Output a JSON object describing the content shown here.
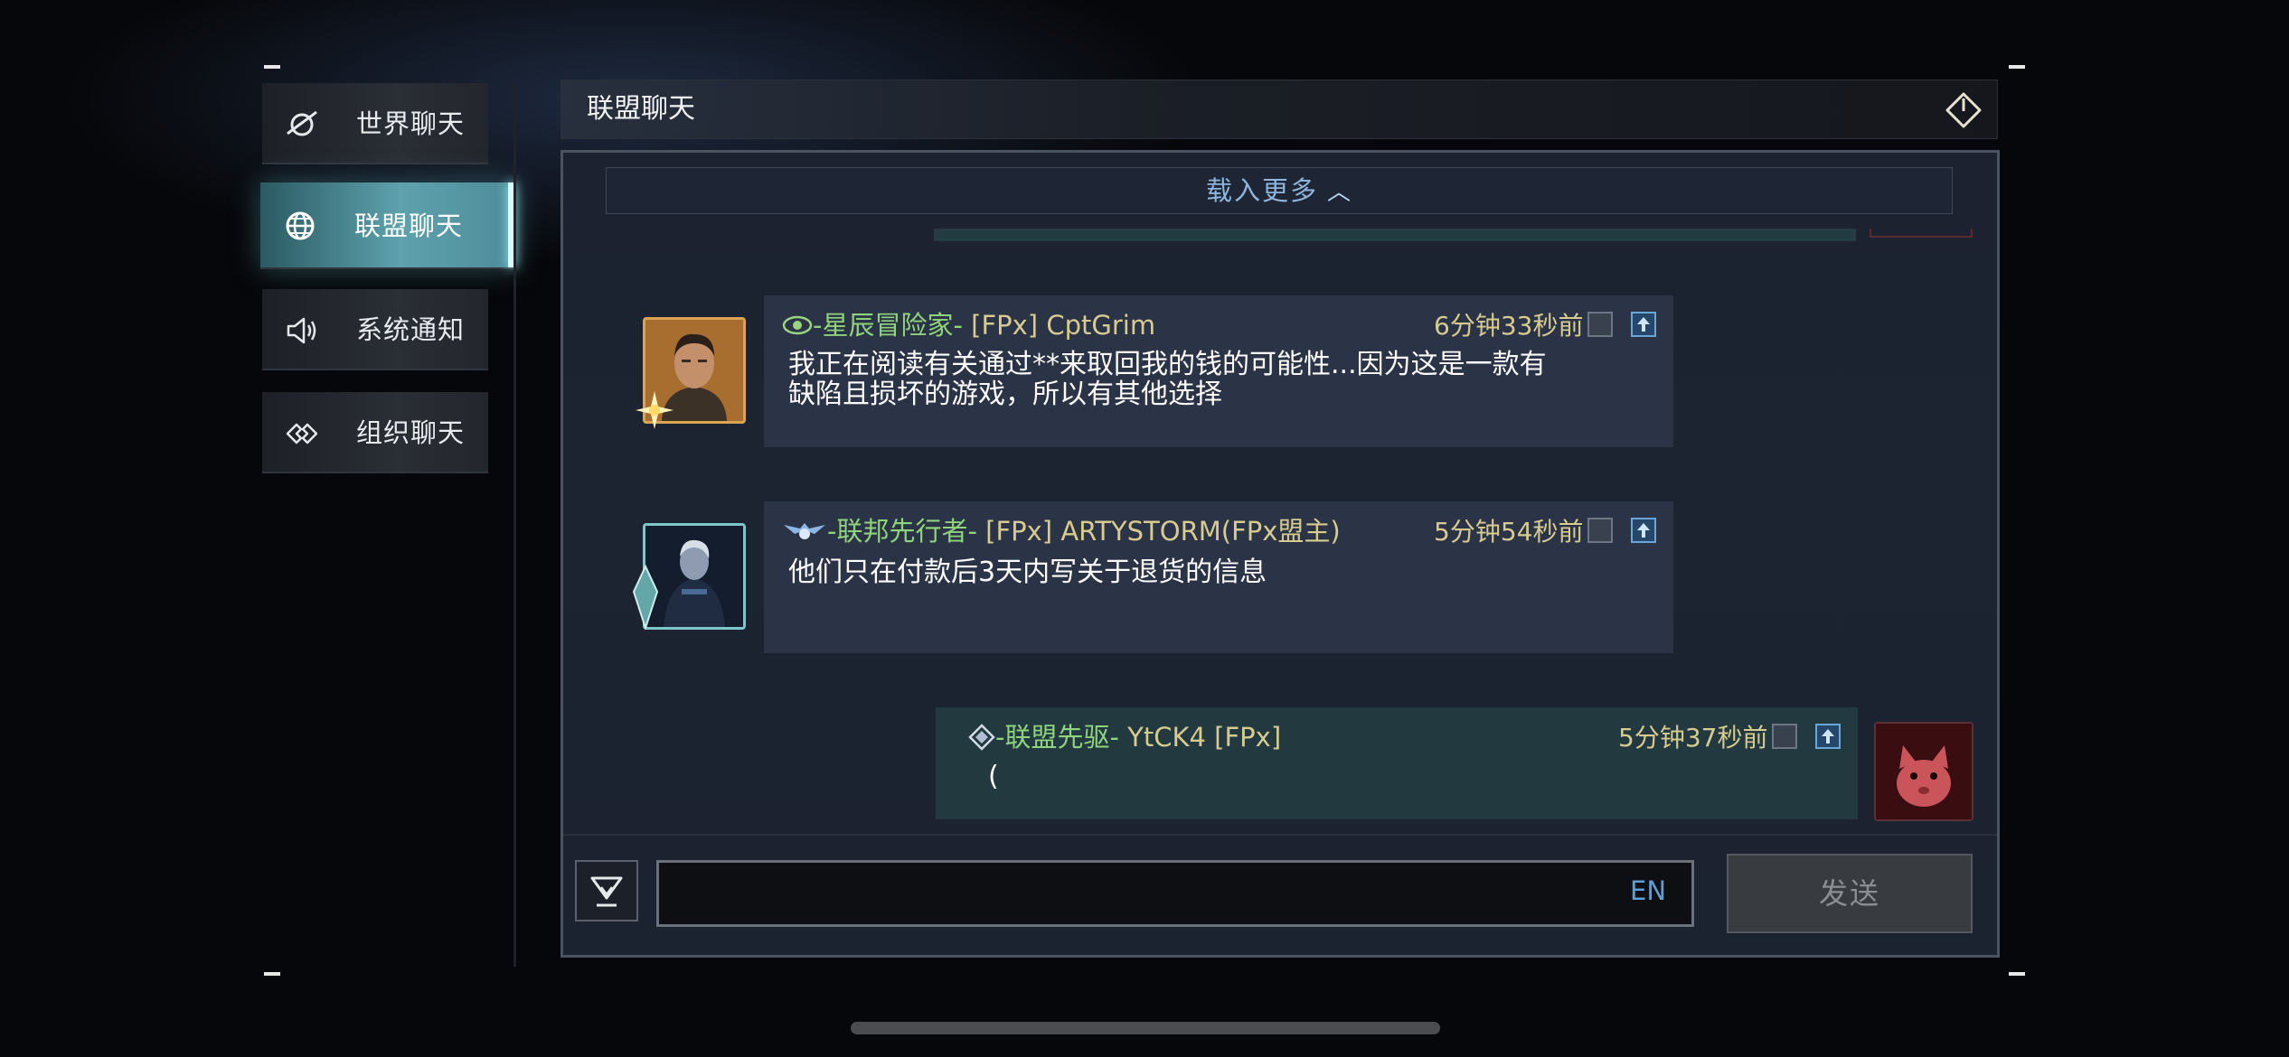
{
  "sidebar": {
    "items": [
      {
        "label": "世界聊天",
        "icon": "planet-icon",
        "active": false
      },
      {
        "label": "联盟聊天",
        "icon": "globe-icon",
        "active": true
      },
      {
        "label": "系统通知",
        "icon": "speaker-icon",
        "active": false
      },
      {
        "label": "组织聊天",
        "icon": "link-icon",
        "active": false
      }
    ]
  },
  "header": {
    "title": "联盟聊天",
    "exit_icon": "exit-icon"
  },
  "chat": {
    "load_more": "载入更多",
    "messages": [
      {
        "rank": "-星辰冒险家-",
        "rank_icon": "eye-badge-icon",
        "user": "[FPx] CptGrim",
        "time": "6分钟33秒前",
        "text_line1": "我正在阅读有关通过**来取回我的钱的可能性...因为这是一款有",
        "text_line2": "缺陷且损坏的游戏，所以有其他选择",
        "avatar": "male-pilot-avatar",
        "mine": false
      },
      {
        "rank": "-联邦先行者-",
        "rank_icon": "winged-badge-icon",
        "user": "[FPx] ARTYSTORM(FPx盟主)",
        "time": "5分钟54秒前",
        "text_line1": "他们只在付款后3天内写关于退货的信息",
        "avatar": "armored-soldier-avatar",
        "mine": false
      },
      {
        "rank": "-联盟先驱-",
        "rank_icon": "diamond-badge-icon",
        "user": "YtCK4 [FPx]",
        "time": "5分钟37秒前",
        "text_line1": "(",
        "avatar": "red-cat-avatar",
        "mine": true
      }
    ]
  },
  "input": {
    "value": "",
    "lang": "EN",
    "send_label": "发送",
    "emoji_icon": "emoji-toggle-icon"
  },
  "colors": {
    "rank_green": "#8fd47c",
    "name_gold": "#d7cb8f",
    "active_tab": "#5ea2ad",
    "load_more_text": "#8fb5dc"
  }
}
